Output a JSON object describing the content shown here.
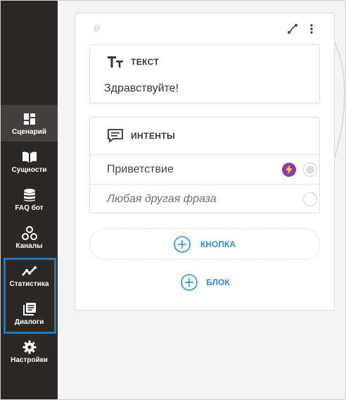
{
  "sidebar": {
    "items": [
      {
        "label": "Сценарий",
        "icon": "dashboard-icon",
        "active": true
      },
      {
        "label": "Сущности",
        "icon": "book-icon"
      },
      {
        "label": "FAQ бот",
        "icon": "database-icon"
      },
      {
        "label": "Каналы",
        "icon": "channels-icon"
      },
      {
        "label": "Статистика",
        "icon": "chart-line-icon"
      },
      {
        "label": "Диалоги",
        "icon": "dialogs-icon"
      },
      {
        "label": "Настройки",
        "icon": "gear-icon"
      }
    ],
    "highlight_color": "#1e78c8"
  },
  "block": {
    "hash": "#",
    "text_card": {
      "title": "ТЕКСТ",
      "body": "Здравствуйте!"
    },
    "intents_card": {
      "title": "ИНТЕНТЫ",
      "rows": [
        {
          "label": "Приветствие"
        },
        {
          "label": "Любая другая фраза"
        }
      ]
    },
    "add_button_label": "КНОПКА",
    "add_block_label": "БЛОК"
  },
  "colors": {
    "accent": "#2f8fc9",
    "sidebar_bg": "#2c2826",
    "bolt": "#8b3aa8"
  }
}
